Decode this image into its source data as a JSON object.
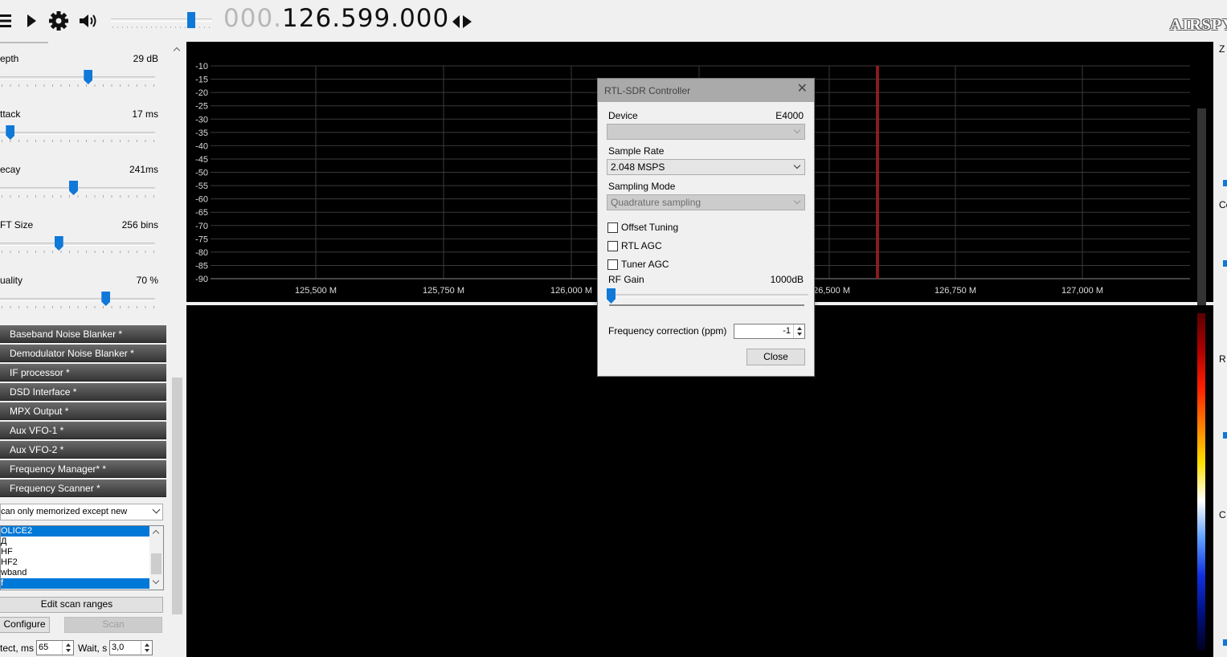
{
  "toolbar": {
    "frequency_dim": "000.",
    "frequency_main": "126.599.000",
    "volume_level": 0.82,
    "logo_text": "AIRSPY"
  },
  "left_panel": {
    "sliders": [
      {
        "label": "epth",
        "value": "29 dB",
        "level": 0.57
      },
      {
        "label": "ttack",
        "value": "17 ms",
        "level": 0.04
      },
      {
        "label": "ecay",
        "value": "241ms",
        "level": 0.47
      },
      {
        "label": "FT Size",
        "value": "256 bins",
        "level": 0.37
      },
      {
        "label": "uality",
        "value": "70 %",
        "level": 0.69
      }
    ],
    "sections": [
      "Baseband Noise Blanker *",
      "Demodulator Noise Blanker *",
      "IF processor *",
      "DSD Interface *",
      "MPX Output *",
      "Aux VFO-1 *",
      "Aux VFO-2 *",
      "Frequency Manager* *",
      "Frequency Scanner *"
    ],
    "scan_mode": "can only memorized except new",
    "scan_list": [
      {
        "label": "OLICE2",
        "selected": true
      },
      {
        "label": "Д",
        "selected": false
      },
      {
        "label": "HF",
        "selected": false
      },
      {
        "label": "HF2",
        "selected": false
      },
      {
        "label": "wband",
        "selected": false
      },
      {
        "label": "f",
        "selected": true
      }
    ],
    "edit_scan_ranges": "Edit scan ranges",
    "configure": "Configure",
    "scan": "Scan",
    "detect_label": "tect, ms",
    "detect_value": "65",
    "wait_label": "Wait, s",
    "wait_value": "3,0"
  },
  "spectrum": {
    "y_ticks": [
      "-10",
      "-15",
      "-20",
      "-25",
      "-30",
      "-35",
      "-40",
      "-45",
      "-50",
      "-55",
      "-60",
      "-65",
      "-70",
      "-75",
      "-80",
      "-85",
      "-90"
    ],
    "x_ticks": [
      "125,500 M",
      "125,750 M",
      "126,000 M",
      "126,500 M",
      "126,750 M",
      "127,000 M"
    ],
    "colors": {
      "grid": "#3a3a3a",
      "marker": "#a02020",
      "text": "#dddddd"
    }
  },
  "dialog": {
    "title": "RTL-SDR Controller",
    "device_label": "Device",
    "device_value": "E4000",
    "device_select": "",
    "sample_rate_label": "Sample Rate",
    "sample_rate_value": "2.048 MSPS",
    "sampling_mode_label": "Sampling Mode",
    "sampling_mode_value": "Quadrature sampling",
    "offset_tuning": "Offset Tuning",
    "rtl_agc": "RTL AGC",
    "tuner_agc": "Tuner AGC",
    "rf_gain_label": "RF Gain",
    "rf_gain_value": "1000dB",
    "rf_gain_level": 0.0,
    "freq_corr_label": "Frequency correction (ppm)",
    "freq_corr_value": "-1",
    "close": "Close",
    "close_x": "✕"
  },
  "right_edge": {
    "labels": [
      "Z",
      "Co",
      "R",
      "C"
    ]
  }
}
